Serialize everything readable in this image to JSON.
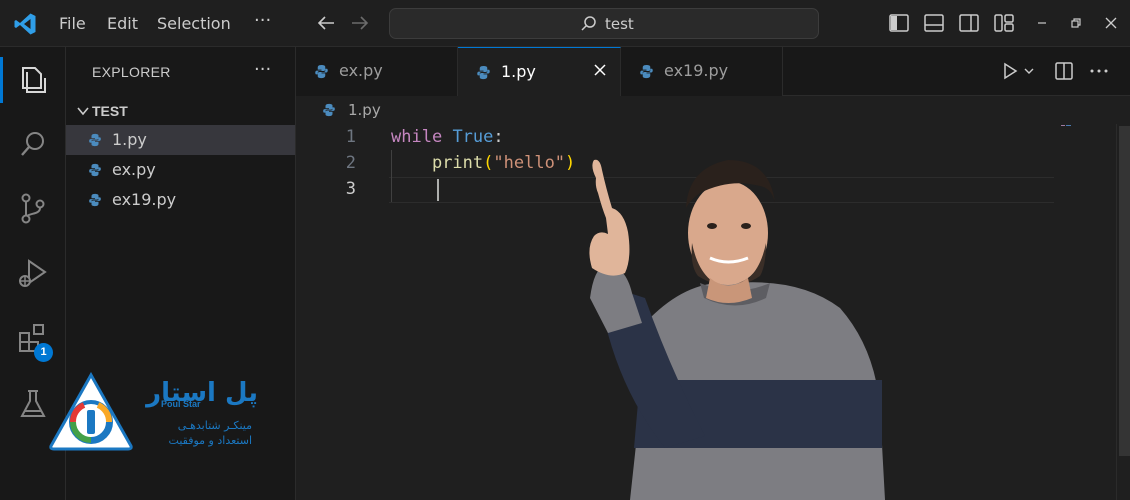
{
  "titlebar": {
    "menu": [
      "File",
      "Edit",
      "Selection"
    ],
    "more": "···",
    "search": "test"
  },
  "activitybar": {
    "items": [
      "explorer-icon",
      "search-icon",
      "source-control-icon",
      "run-debug-icon",
      "extensions-icon",
      "testing-icon"
    ],
    "extensions_badge": "1"
  },
  "sidebar": {
    "title": "EXPLORER",
    "more": "···",
    "folder": "TEST",
    "files": [
      "1.py",
      "ex.py",
      "ex19.py"
    ]
  },
  "tabs": [
    {
      "label": "ex.py",
      "active": false
    },
    {
      "label": "1.py",
      "active": true
    },
    {
      "label": "ex19.py",
      "active": false
    }
  ],
  "breadcrumb": "1.py",
  "editor": {
    "line_numbers": [
      "1",
      "2",
      "3"
    ],
    "line1": {
      "kw": "while",
      "const": "True",
      "colon": ":"
    },
    "line2": {
      "indent": "    ",
      "fn": "print",
      "open": "(",
      "str": "\"hello\"",
      "close": ")"
    }
  },
  "brand": {
    "title_fa": "پل استار",
    "title_en": "Poul Star",
    "subtitle_fa_1": "مینکـر شتابدهـی",
    "subtitle_fa_2": "استعداد و موفقیت"
  },
  "colors": {
    "accent": "#0078d4",
    "brand_blue": "#1b78c2",
    "keyword": "#c586c0",
    "constant": "#569cd6",
    "function": "#dcdcaa",
    "string": "#ce9178"
  }
}
